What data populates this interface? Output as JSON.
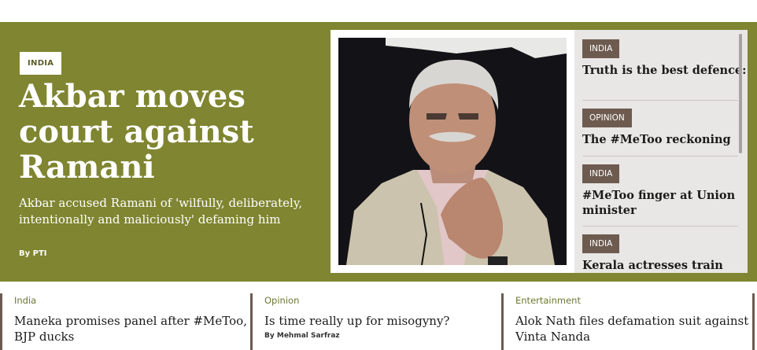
{
  "hero": {
    "tag": "INDIA",
    "title": "Akbar moves court against Ramani",
    "summary": "Akbar accused Ramani of 'wilfully, deliberately, intentionally and maliciously' defaming him",
    "byline": "By PTI",
    "background_color": "#7f8530"
  },
  "side_stories": [
    {
      "tag": "INDIA",
      "headline": "Truth is the best defence: Priya Ramani"
    },
    {
      "tag": "OPINION",
      "headline": "The #MeToo reckoning"
    },
    {
      "tag": "INDIA",
      "headline": "#MeToo finger at Union minister"
    },
    {
      "tag": "INDIA",
      "headline": "Kerala actresses train"
    }
  ],
  "cards": [
    {
      "section": "India",
      "headline": "Maneka promises panel after #MeToo, BJP ducks",
      "byline": ""
    },
    {
      "section": "Opinion",
      "headline": "Is time really up for misogyny?",
      "byline": "By Mehmal Sarfraz"
    },
    {
      "section": "Entertainment",
      "headline": "Alok Nath files defamation suit against Vinta Nanda",
      "byline": ""
    }
  ],
  "colors": {
    "tag_background": "#6e5b50",
    "side_panel": "#e9e7e5",
    "section_text": "#6d7830"
  }
}
